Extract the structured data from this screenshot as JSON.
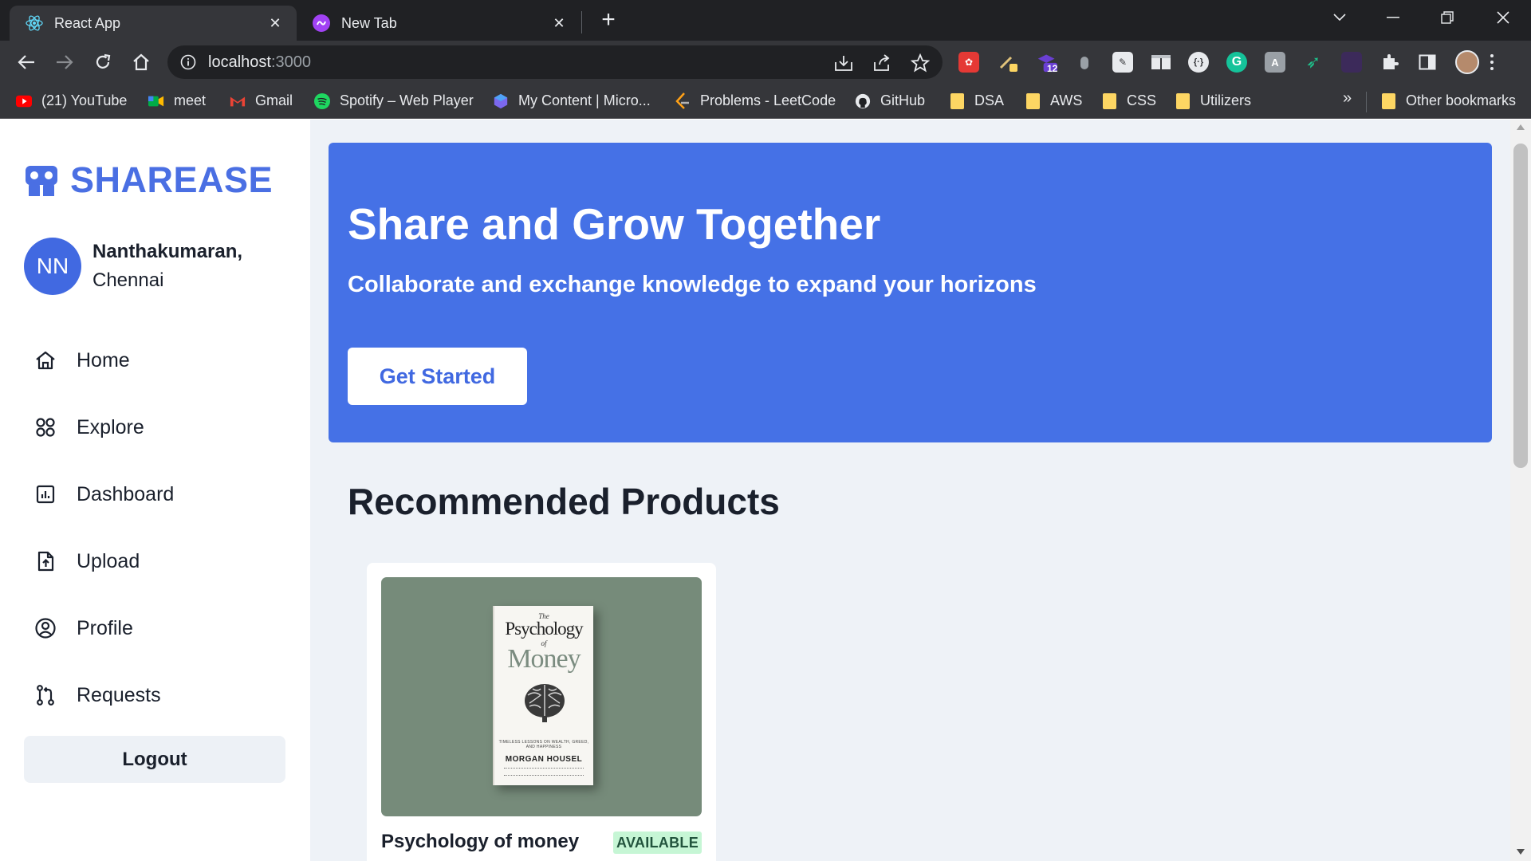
{
  "browser": {
    "tabs": [
      {
        "title": "React App",
        "icon": "react-icon",
        "active": true
      },
      {
        "title": "New Tab",
        "icon": "new-tab-icon",
        "active": false
      }
    ],
    "address": {
      "host": "localhost",
      "port": ":3000"
    },
    "extensions": {
      "badge_count": "12"
    },
    "bookmarks": [
      {
        "label": "(21) YouTube",
        "icon": "youtube-icon"
      },
      {
        "label": "meet",
        "icon": "meet-icon"
      },
      {
        "label": "Gmail",
        "icon": "gmail-icon"
      },
      {
        "label": "Spotify – Web Player",
        "icon": "spotify-icon"
      },
      {
        "label": "My Content | Micro...",
        "icon": "microsoft-icon"
      },
      {
        "label": "Problems - LeetCode",
        "icon": "leetcode-icon"
      },
      {
        "label": "GitHub",
        "icon": "github-icon"
      },
      {
        "label": "DSA",
        "icon": "folder-icon"
      },
      {
        "label": "AWS",
        "icon": "folder-icon"
      },
      {
        "label": "CSS",
        "icon": "folder-icon"
      },
      {
        "label": "Utilizers",
        "icon": "folder-icon"
      }
    ],
    "bookmarks_more": "»",
    "other_bookmarks": "Other bookmarks"
  },
  "app": {
    "brand": "SHAREASE",
    "brand_color": "#4a6fe3",
    "user": {
      "initials": "NN",
      "name": "Nanthakumaran,",
      "city": "Chennai"
    },
    "nav": [
      {
        "label": "Home",
        "icon": "home-icon"
      },
      {
        "label": "Explore",
        "icon": "grid-icon"
      },
      {
        "label": "Dashboard",
        "icon": "chart-icon"
      },
      {
        "label": "Upload",
        "icon": "upload-file-icon"
      },
      {
        "label": "Profile",
        "icon": "user-circle-icon"
      },
      {
        "label": "Requests",
        "icon": "git-pull-request-icon"
      }
    ],
    "logout_label": "Logout"
  },
  "hero": {
    "title": "Share and Grow Together",
    "subtitle": "Collaborate and exchange knowledge to expand your horizons",
    "cta": "Get Started",
    "color": "#4571e6"
  },
  "recommended": {
    "title": "Recommended Products",
    "products": [
      {
        "title": "Psychology of money",
        "status": "AVAILABLE",
        "cover": {
          "the": "The",
          "title1": "Psychology",
          "of": "of",
          "title2": "Money",
          "tagline": "TIMELESS LESSONS ON WEALTH, GREED, AND HAPPINESS",
          "author": "MORGAN HOUSEL"
        }
      }
    ]
  }
}
